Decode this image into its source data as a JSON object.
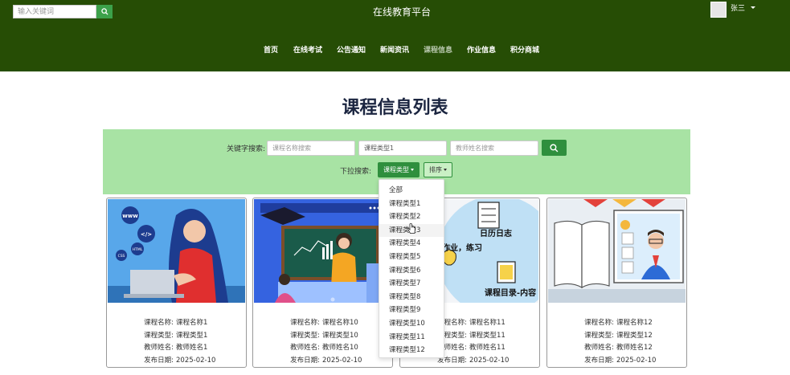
{
  "header": {
    "search_placeholder": "输入关键词",
    "site_title": "在线教育平台",
    "user_name": "张三"
  },
  "nav": {
    "items": [
      "首页",
      "在线考试",
      "公告通知",
      "新闻资讯",
      "课程信息",
      "作业信息",
      "积分商城"
    ],
    "active_index": 4
  },
  "page_title": "课程信息列表",
  "filters": {
    "keyword_label": "关键字搜索:",
    "course_name_placeholder": "课程名称搜索",
    "course_type_value": "课程类型1",
    "teacher_placeholder": "教师姓名搜索",
    "dropdown_label": "下拉搜索:",
    "type_button": "课程类型",
    "sort_button": "排序"
  },
  "dropdown_menu": {
    "items": [
      "全部",
      "课程类型1",
      "课程类型2",
      "课程类型3",
      "课程类型4",
      "课程类型5",
      "课程类型6",
      "课程类型7",
      "课程类型8",
      "课程类型9",
      "课程类型10",
      "课程类型11",
      "课程类型12"
    ],
    "hover_index": 3
  },
  "card_field_labels": {
    "name": "课程名称:",
    "type": "课程类型:",
    "teacher": "教师姓名:",
    "date": "发布日期:"
  },
  "cards": [
    {
      "name": "课程名称1",
      "type": "课程类型1",
      "teacher": "教师姓名1",
      "date": "2025-02-10",
      "image_text": [
        "www",
        "</>",
        "HTML",
        "CSS"
      ]
    },
    {
      "name": "课程名称10",
      "type": "课程类型10",
      "teacher": "教师姓名10",
      "date": "2025-02-10",
      "image_text": []
    },
    {
      "name": "课程名称11",
      "type": "课程类型11",
      "teacher": "教师姓名11",
      "date": "2025-02-10",
      "image_text": [
        "日历日志",
        "作业，练习",
        "课程目录-内容"
      ]
    },
    {
      "name": "课程名称12",
      "type": "课程类型12",
      "teacher": "教师姓名12",
      "date": "2025-02-10",
      "image_text": []
    }
  ],
  "colors": {
    "header_bg": "#264d05",
    "accent_green": "#2f8f3d",
    "filter_bg": "#a8e3a4"
  }
}
